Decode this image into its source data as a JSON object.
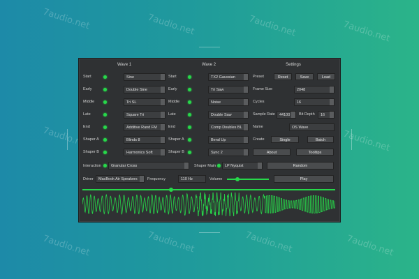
{
  "watermark": "7audio.net",
  "headers": {
    "wave1": "Wave 1",
    "wave2": "Wave 2",
    "settings": "Settings"
  },
  "wave1": [
    {
      "label": "Start",
      "value": "Sine"
    },
    {
      "label": "Early",
      "value": "Double Sine"
    },
    {
      "label": "Middle",
      "value": "Tri SL"
    },
    {
      "label": "Late",
      "value": "Square Tri"
    },
    {
      "label": "End",
      "value": "Additive Rand FM"
    },
    {
      "label": "Shaper A",
      "value": "Blinds 8"
    },
    {
      "label": "Shaper B",
      "value": "Harmonics Soft"
    }
  ],
  "wave2": [
    {
      "label": "Start",
      "value": "TX2 Gaussian"
    },
    {
      "label": "Early",
      "value": "Tri Saw"
    },
    {
      "label": "Middle",
      "value": "Noise"
    },
    {
      "label": "Late",
      "value": "Double Saw"
    },
    {
      "label": "End",
      "value": "Comp Doubles BL"
    },
    {
      "label": "Shaper A",
      "value": "Bend Up"
    },
    {
      "label": "Shaper B",
      "value": "Sync 2"
    }
  ],
  "settings": {
    "preset_label": "Preset",
    "reset": "Reset",
    "save": "Save",
    "load": "Load",
    "frame_size_label": "Frame Size",
    "frame_size": "2048",
    "cycles_label": "Cycles",
    "cycles": "16",
    "sample_rate_label": "Sample Rate",
    "sample_rate": "44100",
    "bit_depth_label": "Bit Depth",
    "bit_depth": "16",
    "name_label": "Name",
    "name": "OS Wave",
    "create_label": "Create",
    "single": "Single",
    "batch": "Batch",
    "about": "About",
    "tooltips": "Tooltips"
  },
  "interaction": {
    "label": "Interaction",
    "value": "Granular Cross"
  },
  "shaper_main": {
    "label": "Shaper Main",
    "value": "LP Nyquist"
  },
  "random": "Random",
  "driver": {
    "label": "Driver",
    "value": "MacBook Air Speakers"
  },
  "frequency": {
    "label": "Frequency",
    "value": "110 Hz"
  },
  "volume": {
    "label": "Volume",
    "level": 0.25
  },
  "play": "Play",
  "position": {
    "level": 0.35
  },
  "colors": {
    "accent": "#27d84a",
    "panel": "#2f3133"
  }
}
